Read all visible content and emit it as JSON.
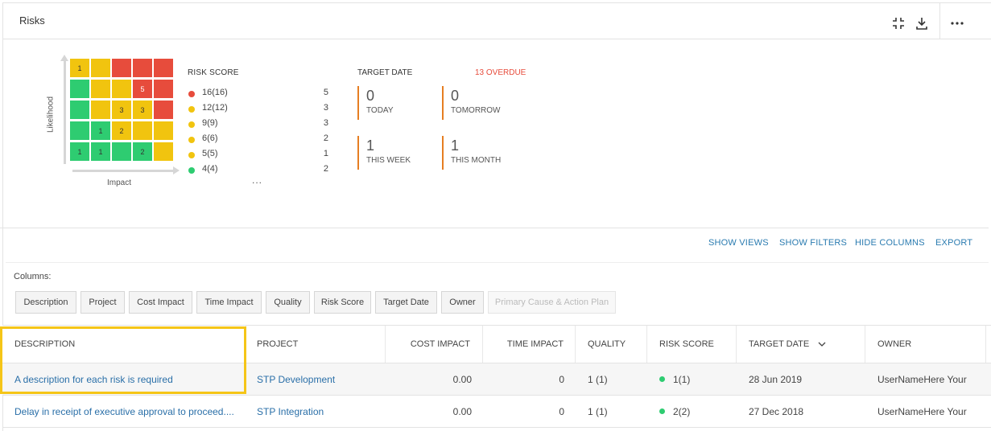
{
  "panel": {
    "title": "Risks"
  },
  "header_icons": [
    "collapse-icon",
    "download-icon",
    "more-icon"
  ],
  "matrix": {
    "y_label": "Likelihood",
    "x_label": "Impact",
    "rows": [
      [
        {
          "c": "y",
          "v": "1"
        },
        {
          "c": "y",
          "v": ""
        },
        {
          "c": "r",
          "v": ""
        },
        {
          "c": "r",
          "v": ""
        },
        {
          "c": "r",
          "v": ""
        }
      ],
      [
        {
          "c": "g",
          "v": ""
        },
        {
          "c": "y",
          "v": ""
        },
        {
          "c": "y",
          "v": ""
        },
        {
          "c": "r",
          "v": "5"
        },
        {
          "c": "r",
          "v": ""
        }
      ],
      [
        {
          "c": "g",
          "v": ""
        },
        {
          "c": "y",
          "v": ""
        },
        {
          "c": "y",
          "v": "3"
        },
        {
          "c": "y",
          "v": "3"
        },
        {
          "c": "r",
          "v": ""
        }
      ],
      [
        {
          "c": "g",
          "v": ""
        },
        {
          "c": "g",
          "v": "1"
        },
        {
          "c": "y",
          "v": "2"
        },
        {
          "c": "y",
          "v": ""
        },
        {
          "c": "y",
          "v": ""
        }
      ],
      [
        {
          "c": "g",
          "v": "1"
        },
        {
          "c": "g",
          "v": "1"
        },
        {
          "c": "g",
          "v": ""
        },
        {
          "c": "g",
          "v": "2"
        },
        {
          "c": "y",
          "v": ""
        }
      ]
    ],
    "colors": {
      "g": "#2ecc71",
      "y": "#f1c40f",
      "r": "#e74c3c"
    }
  },
  "risk_score": {
    "title": "RISK SCORE",
    "items": [
      {
        "label": "16(16)",
        "count": "5",
        "color": "#e74c3c"
      },
      {
        "label": "12(12)",
        "count": "3",
        "color": "#f1c40f"
      },
      {
        "label": "9(9)",
        "count": "3",
        "color": "#f1c40f"
      },
      {
        "label": "6(6)",
        "count": "2",
        "color": "#f1c40f"
      },
      {
        "label": "5(5)",
        "count": "1",
        "color": "#f1c40f"
      },
      {
        "label": "4(4)",
        "count": "2",
        "color": "#2ecc71"
      }
    ],
    "more": "..."
  },
  "target_date": {
    "title": "TARGET DATE",
    "overdue": "13 OVERDUE",
    "boxes": [
      {
        "value": "0",
        "label": "TODAY"
      },
      {
        "value": "0",
        "label": "TOMORROW"
      },
      {
        "value": "1",
        "label": "THIS WEEK"
      },
      {
        "value": "1",
        "label": "THIS MONTH"
      }
    ]
  },
  "toolbar": {
    "show_views": "SHOW VIEWS",
    "show_filters": "SHOW FILTERS",
    "hide_columns": "HIDE COLUMNS",
    "export": "EXPORT"
  },
  "columns_panel": {
    "label": "Columns:",
    "chips": [
      "Description",
      "Project",
      "Cost Impact",
      "Time Impact",
      "Quality",
      "Risk Score",
      "Target Date",
      "Owner",
      "Primary Cause & Action Plan"
    ]
  },
  "table": {
    "headers": [
      "DESCRIPTION",
      "PROJECT",
      "COST IMPACT",
      "TIME IMPACT",
      "QUALITY",
      "RISK SCORE",
      "TARGET DATE",
      "OWNER"
    ],
    "rows": [
      {
        "description": "A description for each risk is required",
        "project": "STP Development",
        "cost": "0.00",
        "time": "0",
        "quality": "1 (1)",
        "score": "1(1)",
        "date": "28 Jun 2019",
        "owner": "UserNameHere Your"
      },
      {
        "description": "Delay in receipt of executive approval to proceed....",
        "project": "STP Integration",
        "cost": "0.00",
        "time": "0",
        "quality": "1 (1)",
        "score": "2(2)",
        "date": "27 Dec 2018",
        "owner": "UserNameHere Your"
      }
    ]
  }
}
